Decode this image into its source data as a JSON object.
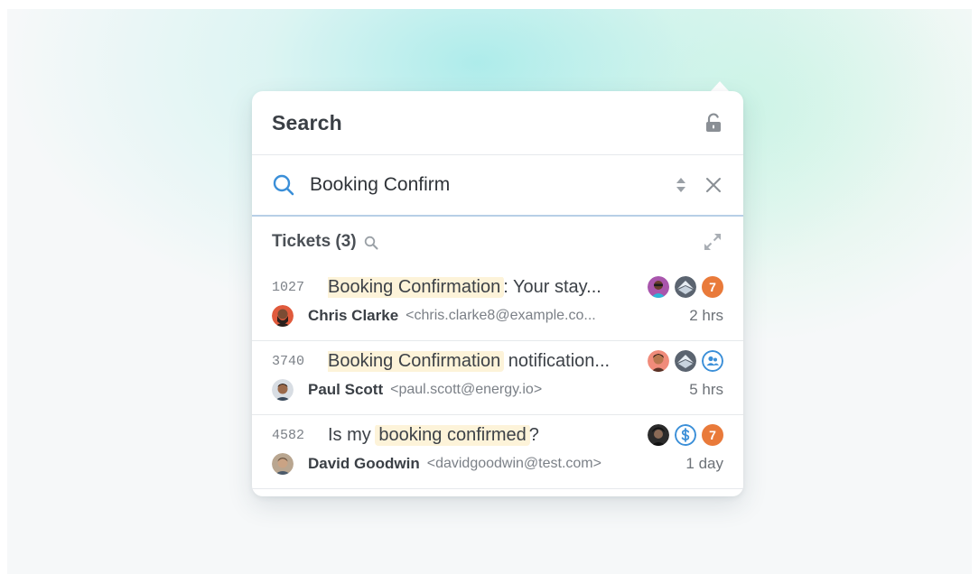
{
  "header": {
    "title": "Search"
  },
  "search": {
    "value": "Booking Confirm",
    "placeholder": ""
  },
  "section": {
    "label": "Tickets (3)"
  },
  "tickets": [
    {
      "id": "1027",
      "subject": {
        "highlight": "Booking Confirmation",
        "rest": ": Your stay..."
      },
      "badge_number": "7",
      "requester": {
        "name": "Chris Clarke",
        "email": "<chris.clarke8@example.co...",
        "time": "2 hrs"
      }
    },
    {
      "id": "3740",
      "subject": {
        "highlight": "Booking Confirmation",
        "rest": " notification..."
      },
      "requester": {
        "name": "Paul Scott",
        "email": "<paul.scott@energy.io>",
        "time": "5 hrs"
      }
    },
    {
      "id": "4582",
      "subject": {
        "prefix": "Is my ",
        "highlight": "booking confirmed",
        "rest": "?"
      },
      "badge_number": "7",
      "requester": {
        "name": "David Goodwin",
        "email": "<davidgoodwin@test.com>",
        "time": "1 day"
      }
    }
  ],
  "colors": {
    "accent": "#3b8fd8",
    "highlight": "#fdf3d9",
    "badge_orange": "#e97a3a"
  }
}
